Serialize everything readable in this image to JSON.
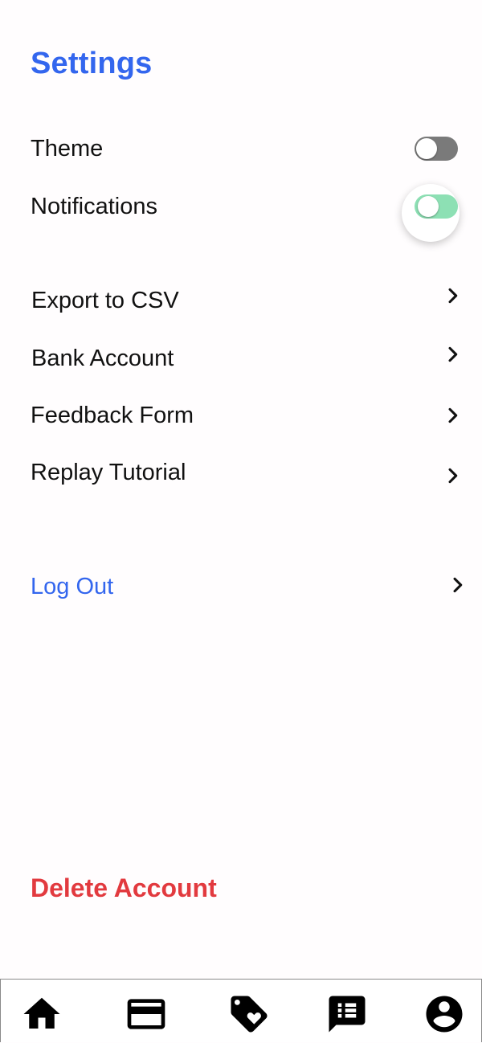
{
  "header": {
    "title": "Settings"
  },
  "toggles": [
    {
      "label": "Theme",
      "state": "off"
    },
    {
      "label": "Notifications",
      "state": "on"
    }
  ],
  "menu": [
    {
      "label": "Export to CSV"
    },
    {
      "label": "Bank Account"
    },
    {
      "label": "Feedback Form"
    },
    {
      "label": "Replay Tutorial"
    }
  ],
  "logout": {
    "label": "Log Out"
  },
  "delete": {
    "label": "Delete Account"
  },
  "nav": [
    {
      "icon": "home-icon"
    },
    {
      "icon": "credit-card-icon"
    },
    {
      "icon": "tag-heart-icon"
    },
    {
      "icon": "message-list-icon"
    },
    {
      "icon": "account-icon"
    }
  ],
  "colors": {
    "accent": "#3366ee",
    "danger": "#e23a3f",
    "toggle_on": "#8de0b4",
    "toggle_off": "#7a7a7a"
  }
}
